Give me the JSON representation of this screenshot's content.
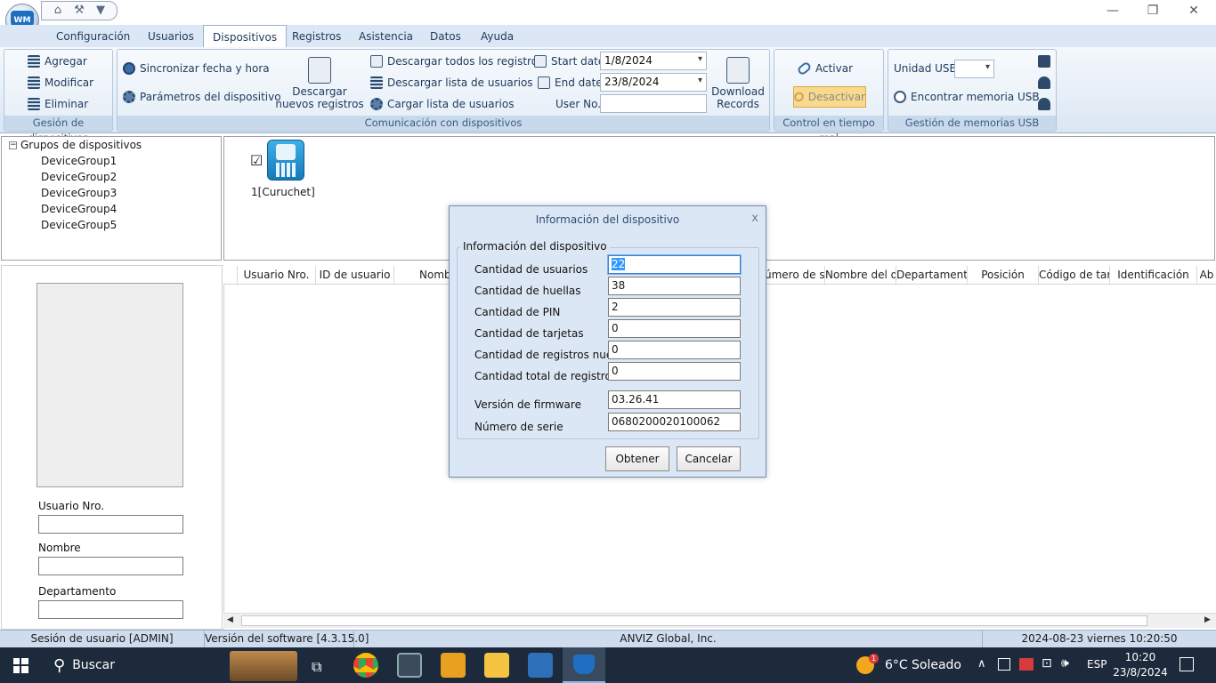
{
  "titlebar": {
    "logo_text": "WM",
    "window_controls": {
      "minimize": "—",
      "restore": "❐",
      "close": "✕"
    }
  },
  "menu_tabs": [
    {
      "label": "Configuración",
      "active": false
    },
    {
      "label": "Usuarios",
      "active": false
    },
    {
      "label": "Dispositivos",
      "active": true
    },
    {
      "label": "Registros",
      "active": false
    },
    {
      "label": "Asistencia",
      "active": false
    },
    {
      "label": "Datos",
      "active": false
    },
    {
      "label": "Ayuda",
      "active": false
    }
  ],
  "ribbon": {
    "device_mgmt": {
      "add": "Agregar",
      "modify": "Modificar",
      "delete": "Eliminar",
      "label": "Gesión de dispositivos"
    },
    "communication": {
      "sync_time": "Sincronizar fecha y hora",
      "device_params": "Parámetros del dispositivo",
      "download_new_1": "Descargar",
      "download_new_2": "nuevos registros",
      "download_all": "Descargar todos los registros",
      "download_users": "Descargar lista de usuarios",
      "upload_users": "Cargar lista de usuarios",
      "start_date_label": "Start date",
      "start_date_value": "1/8/2024",
      "end_date_label": "End date",
      "end_date_value": "23/8/2024",
      "user_no_label": "User No.",
      "user_no_value": "",
      "download_records_1": "Download",
      "download_records_2": "Records",
      "label": "Comunicación con dispositivos"
    },
    "realtime": {
      "activate": "Activar",
      "deactivate": "Desactivar",
      "label": "Control en tiempo real"
    },
    "usb": {
      "drive_label": "Unidad USB",
      "drive_value": "",
      "find": "Encontrar memoria USB",
      "label": "Gestión de memorias USB"
    }
  },
  "tree": {
    "root": "Grupos de dispositivos",
    "items": [
      "DeviceGroup1",
      "DeviceGroup2",
      "DeviceGroup3",
      "DeviceGroup4",
      "DeviceGroup5"
    ]
  },
  "device": {
    "checked": "☑",
    "name": "1[Curuchet]"
  },
  "left_form": {
    "user_no_label": "Usuario Nro.",
    "name_label": "Nombre",
    "dept_label": "Departamento"
  },
  "table_columns": [
    "Usuario Nro.",
    "ID de usuario",
    "Nomb",
    "úmero de se",
    "Nombre del d",
    "Departamento",
    "Posición",
    "Código de tar",
    "Identificación",
    "Ab"
  ],
  "dialog": {
    "title": "Información del dispositivo",
    "close": "x",
    "legend": "Información del dispositivo",
    "rows": [
      {
        "label": "Cantidad de usuarios",
        "value": "22"
      },
      {
        "label": "Cantidad de huellas",
        "value": "38"
      },
      {
        "label": "Cantidad de PIN",
        "value": "2"
      },
      {
        "label": "Cantidad de tarjetas",
        "value": "0"
      },
      {
        "label": "Cantidad de registros nuevos",
        "value": "0"
      },
      {
        "label": "Cantidad total de registros",
        "value": "0"
      },
      {
        "label": "Versión de firmware",
        "value": "03.26.41"
      },
      {
        "label": "Número de serie",
        "value": "0680200020100062"
      }
    ],
    "ok": "Obtener",
    "cancel": "Cancelar"
  },
  "statusbar": {
    "session": "Sesión de usuario  [ADMIN]",
    "version": "Versión del software  [4.3.15.0]",
    "company": "ANVIZ Global, Inc.",
    "datetime": "2024-08-23 viernes 10:20:50"
  },
  "taskbar": {
    "search": "Buscar",
    "weather_temp": "6°C",
    "weather_desc": "Soleado",
    "weather_badge": "1",
    "lang": "ESP",
    "time": "10:20",
    "date": "23/8/2024"
  }
}
